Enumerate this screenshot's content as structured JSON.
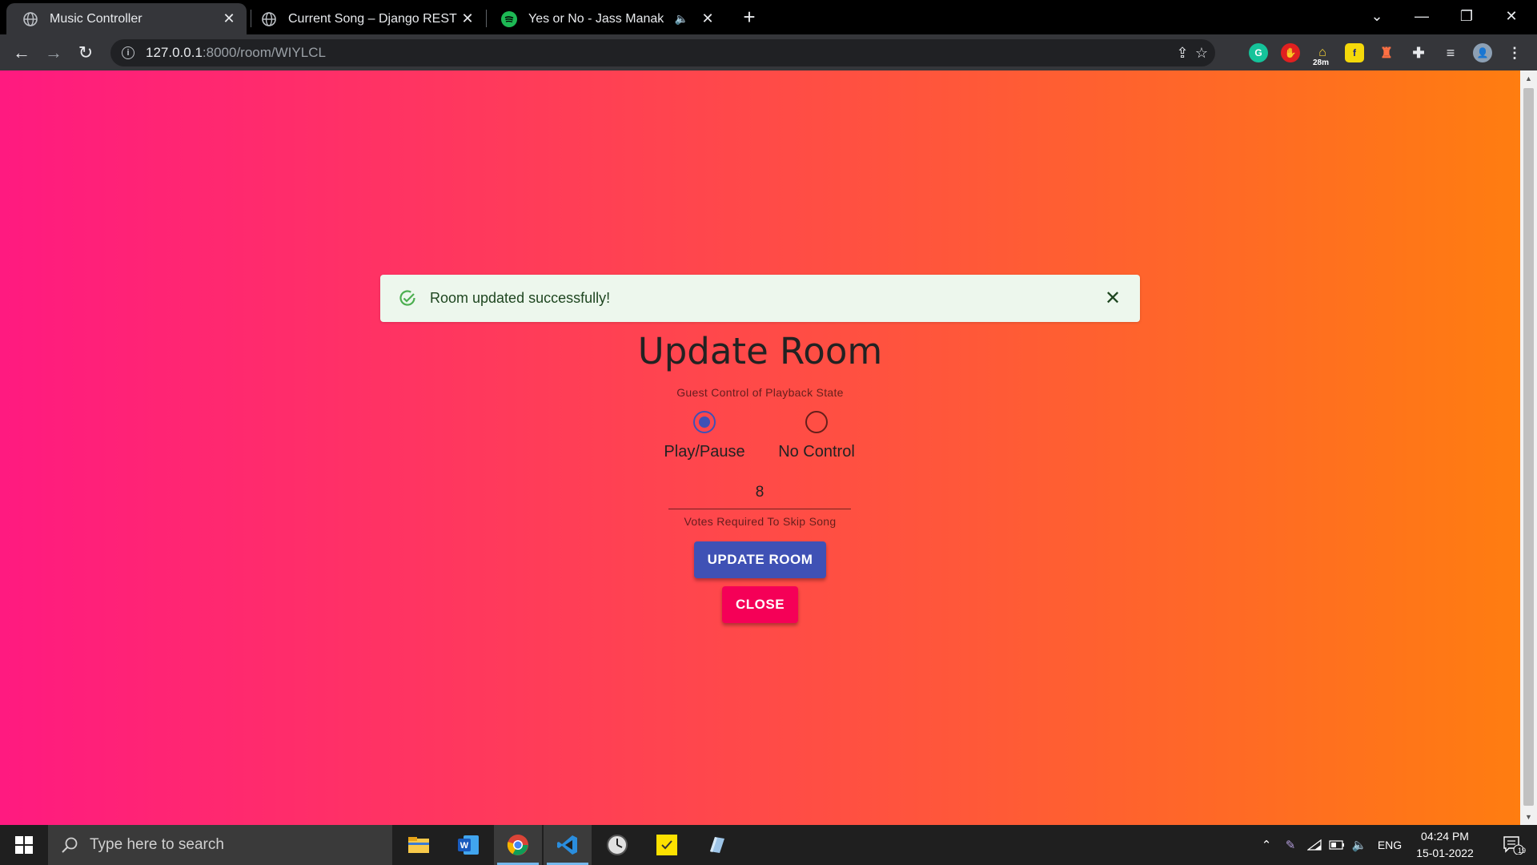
{
  "browser": {
    "tabs": [
      {
        "title": "Music Controller",
        "active": true
      },
      {
        "title": "Current Song – Django REST fran",
        "active": false
      },
      {
        "title": "Yes or No - Jass Manak",
        "active": false,
        "audio": true
      }
    ],
    "url_host": "127.0.0.1",
    "url_path": ":8000/room/WIYLCL",
    "extension_badge": "28m"
  },
  "page": {
    "alert_message": "Room updated successfully!",
    "title": "Update Room",
    "guest_control_label": "Guest Control of Playback State",
    "radio_options": [
      {
        "label": "Play/Pause",
        "selected": true
      },
      {
        "label": "No Control",
        "selected": false
      }
    ],
    "votes_value": "8",
    "votes_label": "Votes Required To Skip Song",
    "update_button": "UPDATE ROOM",
    "close_button": "CLOSE",
    "colors": {
      "gradient_start": "#ff1a80",
      "gradient_end": "#ff7d10",
      "primary": "#3f51b5",
      "secondary": "#f50057",
      "success_bg": "#edf7ed"
    }
  },
  "taskbar": {
    "search_placeholder": "Type here to search",
    "language": "ENG",
    "time": "04:24 PM",
    "date": "15-01-2022",
    "notification_count": "19"
  }
}
